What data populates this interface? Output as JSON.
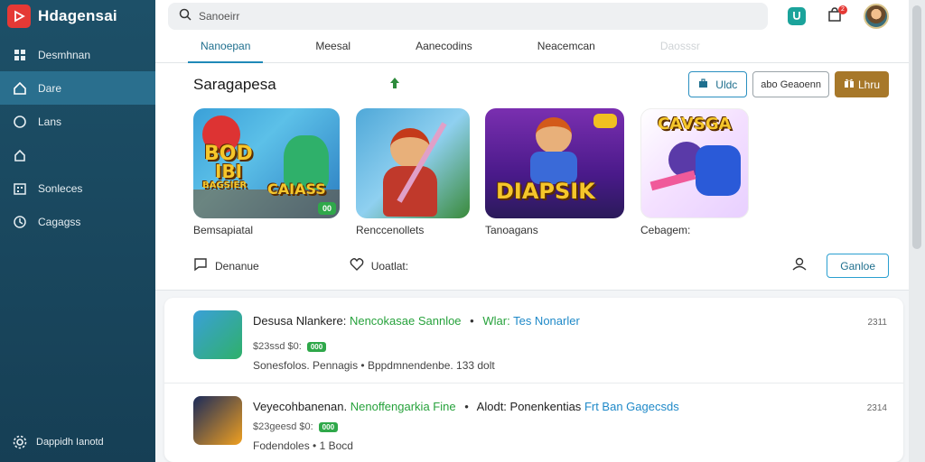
{
  "app": {
    "title": "Hdagensai"
  },
  "sidebar": {
    "items": [
      {
        "label": "Desmhnan",
        "icon": "grid-icon",
        "active": false
      },
      {
        "label": "Dare",
        "icon": "home-icon",
        "active": true
      },
      {
        "label": "Lans",
        "icon": "circle-icon",
        "active": false
      },
      {
        "label": "",
        "icon": "house-outline-icon",
        "active": false
      },
      {
        "label": "Sonleces",
        "icon": "calendar-icon",
        "active": false
      },
      {
        "label": "Cagagss",
        "icon": "clock-icon",
        "active": false
      }
    ],
    "footer": {
      "label": "Dappidh Ianotd",
      "icon": "gear-icon"
    }
  },
  "header": {
    "search": {
      "value": "Sanoeirr",
      "placeholder": "Search"
    },
    "notification_count": "2",
    "tabs": [
      {
        "label": "Nanoepan",
        "active": true
      },
      {
        "label": "Meesal",
        "active": false
      },
      {
        "label": "Aanecodins",
        "active": false
      },
      {
        "label": "Neacemcan",
        "active": false
      },
      {
        "label": "Daosssr",
        "active": false,
        "faded": true
      }
    ]
  },
  "featured": {
    "title": "Saragapesa",
    "actions": {
      "primary": "Uldc",
      "secondary": "abo Geaoenn",
      "gold": "Lhru"
    },
    "cards": [
      {
        "label": "Bemsapiatal",
        "art_text_top": "BOD",
        "art_text_mid": "IBI",
        "art_text_bot": "BAGSIER",
        "art_text_side": "CAIASS",
        "badge": "00"
      },
      {
        "label": "Renccenollets",
        "art_text_top": "",
        "art_text_mid": "",
        "art_text_bot": "",
        "art_text_side": "",
        "badge": ""
      },
      {
        "label": "Tanoagans",
        "art_text_top": "",
        "art_text_mid": "DIAPSIK",
        "art_text_bot": "",
        "art_text_side": "",
        "badge": ""
      },
      {
        "label": "Cebagem:",
        "art_text_top": "CAVSGA",
        "art_text_mid": "",
        "art_text_bot": "",
        "art_text_side": "",
        "badge": ""
      }
    ],
    "social": [
      {
        "label": "Denanue",
        "icon": "comment-icon"
      },
      {
        "label": "Uoatlat:",
        "icon": "heart-icon"
      }
    ],
    "follow_button": "Ganloe"
  },
  "list": [
    {
      "title_dark": "Desusa Nlankere:",
      "title_green": "Nencokasae Sannloe",
      "title_sep": "•",
      "title_green2": "Wlar:",
      "title_blue": "Tes Nonarler",
      "price": "$23ssd $0:",
      "badge": "000",
      "meta": "Sonesfolos.  Pennagis •  Bppdmnendenbe.  133 dolt",
      "time": "2311"
    },
    {
      "title_dark": "Veyecohbanenan.",
      "title_green": "Nenoffengarkia Fine",
      "title_sep": "•",
      "title_green2": "Alodt: Ponenkentias",
      "title_blue": "Frt Ban Gagecsds",
      "price": "$23geesd $0:",
      "badge": "000",
      "meta": "Fodendoles • 1 Bocd",
      "time": "2314"
    }
  ]
}
